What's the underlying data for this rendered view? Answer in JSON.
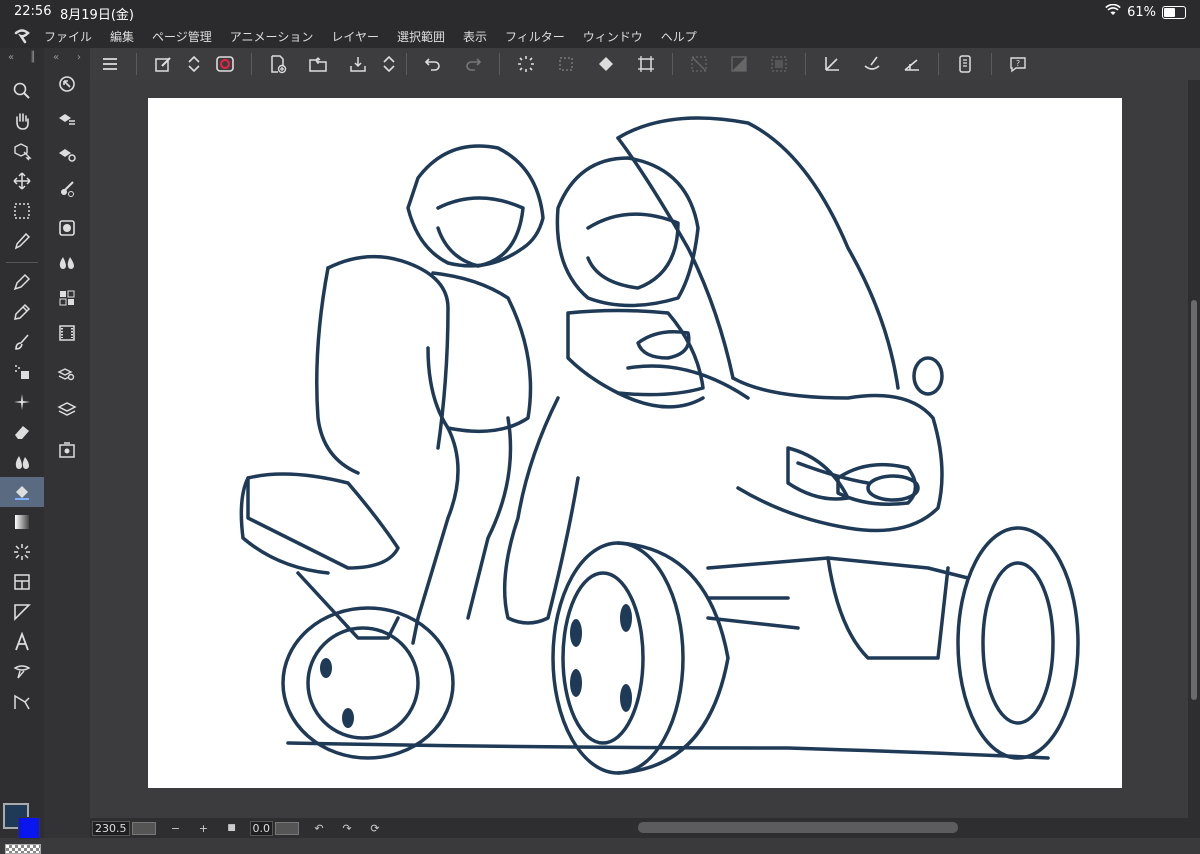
{
  "status": {
    "time": "22:56",
    "date": "8月19日(金)",
    "battery_text": "61%",
    "battery_level": 0.61
  },
  "menu": {
    "items": [
      "ファイル",
      "編集",
      "ページ管理",
      "アニメーション",
      "レイヤー",
      "選択範囲",
      "表示",
      "フィルター",
      "ウィンドウ",
      "ヘルプ"
    ]
  },
  "bottom": {
    "zoom_value": "230.5",
    "minus": "−",
    "plus": "+",
    "stop": "■",
    "rotate_value": "0.0",
    "rotate_left": "↶",
    "rotate_right": "↷",
    "reset": "⟳"
  },
  "colors": {
    "main": "#1e3a57",
    "sub": "#0a16f0",
    "line_art": "#1e3a57"
  },
  "icons": {
    "toolbar": [
      "menu-icon",
      "edit-page-icon",
      "up-down-icon",
      "clip-studio-icon",
      "new-canvas-icon",
      "open-folder-icon",
      "save-icon",
      "up-down-icon",
      "undo-icon",
      "redo-icon",
      "loading-icon",
      "deselect-icon",
      "fill-icon",
      "transform-icon",
      "clear-icon",
      "invert-selection-icon",
      "selection-border-icon",
      "ruler-snap-icon",
      "special-ruler-snap-icon",
      "grid-snap-icon",
      "device-icon",
      "help-icon"
    ],
    "tools": [
      "zoom-icon",
      "hand-icon",
      "operation-icon",
      "move-icon",
      "selection-icon",
      "eyedropper-icon",
      "pen-icon",
      "pencil-icon",
      "brush-icon",
      "airbrush-icon",
      "decoration-icon",
      "eraser-icon",
      "blend-icon",
      "fill-icon",
      "gradient-icon",
      "figure-icon",
      "frame-icon",
      "ruler-icon",
      "text-icon",
      "balloon-icon",
      "line-correction-icon"
    ],
    "subtools": [
      "navigator-icon",
      "layer-property-icon",
      "layer-settings-icon",
      "brush-size-icon",
      "color-wheel-icon",
      "color-set-icon",
      "material-icon",
      "animation-icon",
      "layer-search-icon",
      "layer-icon",
      "sub-view-icon"
    ]
  }
}
